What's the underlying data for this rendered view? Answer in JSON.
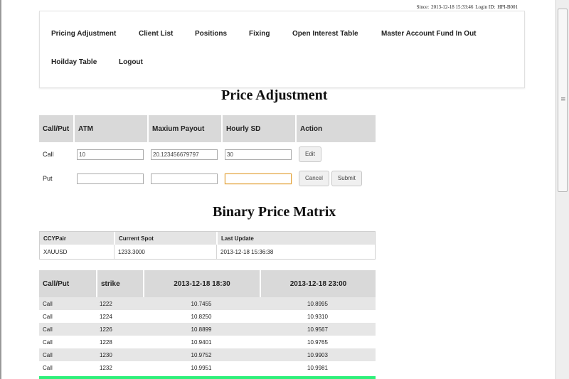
{
  "session": {
    "since_label": "Since:",
    "since_value": "2013-12-18 15:33:46",
    "login_label": "Login ID:",
    "login_value": "HPI-B001"
  },
  "nav": {
    "items": [
      "Pricing Adjustment",
      "Client List",
      "Positions",
      "Fixing",
      "Open Interest Table",
      "Master Account Fund In Out",
      "Hoilday Table",
      "Logout"
    ]
  },
  "price_adjustment": {
    "title": "Price Adjustment",
    "headers": [
      "Call/Put",
      "ATM",
      "Maxium Payout",
      "Hourly SD",
      "Action"
    ],
    "call": {
      "label": "Call",
      "atm": "10",
      "max_payout": "20.123456679797",
      "hourly_sd": "30",
      "edit_label": "Edit"
    },
    "put": {
      "label": "Put",
      "atm": "",
      "max_payout": "",
      "hourly_sd": "",
      "cancel_label": "Cancel",
      "submit_label": "Submit"
    }
  },
  "binary_matrix": {
    "title": "Binary Price Matrix",
    "spot_headers": [
      "CCYPair",
      "Current Spot",
      "Last Update"
    ],
    "spot_row": [
      "XAUUSD",
      "1233.3000",
      "2013-12-18 15:36:38"
    ],
    "matrix_headers": [
      "Call/Put",
      "strike",
      "2013-12-18 18:30",
      "2013-12-18 23:00"
    ],
    "rows": [
      [
        "Call",
        "1222",
        "10.7455",
        "10.8995"
      ],
      [
        "Call",
        "1224",
        "10.8250",
        "10.9310"
      ],
      [
        "Call",
        "1226",
        "10.8899",
        "10.9567"
      ],
      [
        "Call",
        "1228",
        "10.9401",
        "10.9765"
      ],
      [
        "Call",
        "1230",
        "10.9752",
        "10.9903"
      ],
      [
        "Call",
        "1232",
        "10.9951",
        "10.9981"
      ]
    ]
  },
  "colors": {
    "header_gray": "#d9d9d9",
    "highlight_green": "#2ef07a",
    "focus_orange": "#e3a33b"
  }
}
